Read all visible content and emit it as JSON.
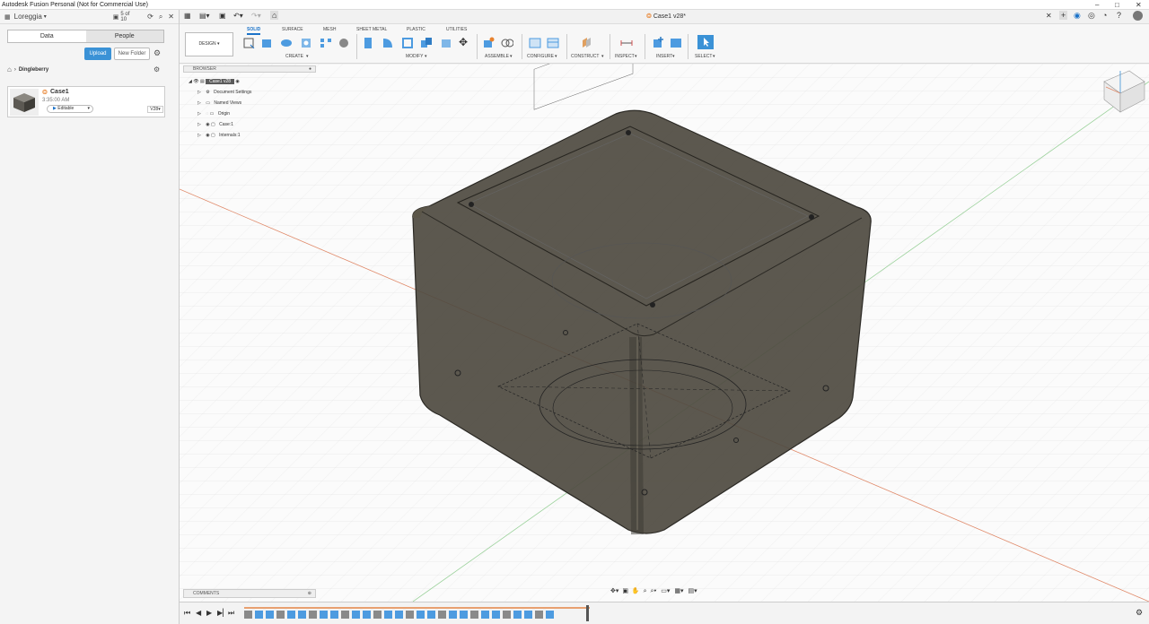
{
  "window": {
    "title": "Autodesk Fusion Personal (Not for Commercial Use)"
  },
  "datapanel": {
    "user": "Loreggia",
    "page_count": "5 of 10",
    "tabs": [
      "Data",
      "People"
    ],
    "upload_label": "Upload",
    "new_folder_label": "New Folder",
    "breadcrumb": "Dingleberry",
    "file": {
      "name": "Case1",
      "time": "3:35:00 AM",
      "status": "Editable",
      "version": "V28"
    }
  },
  "document": {
    "tab_title": "Case1 v28*"
  },
  "ribbon": {
    "workspace": "DESIGN",
    "tabs": [
      "SOLID",
      "SURFACE",
      "MESH",
      "SHEET METAL",
      "PLASTIC",
      "UTILITIES"
    ],
    "groups": [
      "CREATE",
      "MODIFY",
      "ASSEMBLE",
      "CONFIGURE",
      "CONSTRUCT",
      "INSPECT",
      "INSERT",
      "SELECT"
    ]
  },
  "browser": {
    "title": "BROWSER",
    "root": "Case1 v28",
    "items": [
      "Document Settings",
      "Named Views",
      "Origin",
      "Case:1",
      "Internals:1"
    ]
  },
  "comments": {
    "title": "COMMENTS"
  },
  "colors": {
    "accent": "#1b72c8",
    "upload": "#3b92d6",
    "model_fill": "#4e4a40",
    "grid": "#dcdcdc",
    "axis_red": "#e08a6a",
    "axis_green": "#9cd29c"
  }
}
